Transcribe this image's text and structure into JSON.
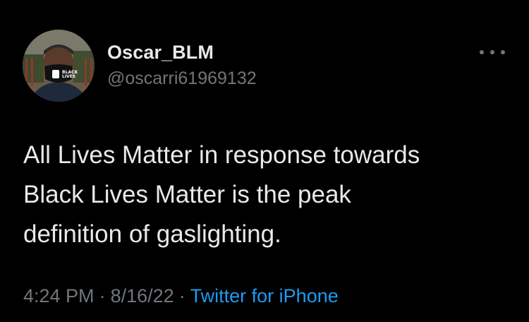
{
  "user": {
    "display_name": "Oscar_BLM",
    "handle": "@oscarri61969132"
  },
  "tweet": {
    "lines": [
      "All Lives Matter in response towards",
      "Black Lives Matter is the peak",
      "definition of gaslighting."
    ]
  },
  "meta": {
    "time": "4:24 PM",
    "separator": "·",
    "date": "8/16/22",
    "source": "Twitter for iPhone"
  },
  "icons": {
    "more": "more-options-icon"
  },
  "colors": {
    "background": "#000000",
    "primary_text": "#e7e9ea",
    "secondary_text": "#71767b",
    "link": "#1d9bf0"
  }
}
